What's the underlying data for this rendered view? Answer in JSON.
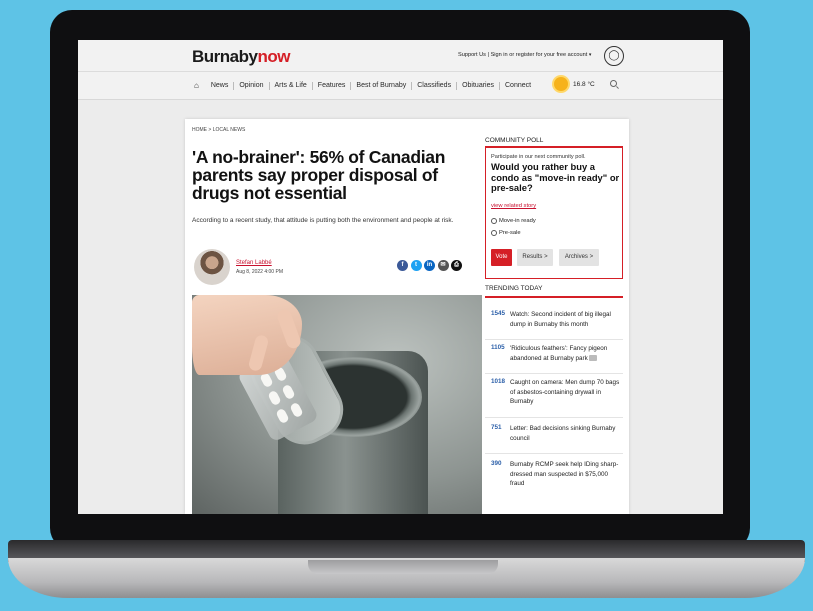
{
  "header": {
    "logo_part1": "Burnaby",
    "logo_part2": "now",
    "support": "Support Us",
    "signin": "Sign in or register for your free account",
    "caret": "▾"
  },
  "nav": {
    "items": [
      "News",
      "Opinion",
      "Arts & Life",
      "Features",
      "Best of Burnaby",
      "Classifieds",
      "Obituaries",
      "Connect"
    ],
    "temperature": "16.8 °C"
  },
  "article": {
    "breadcrumb": "HOME > LOCAL NEWS",
    "headline": "'A no-brainer': 56% of Canadian parents say proper disposal of drugs not essential",
    "subhead": "According to a recent study, that attitude is putting both the environment and people at risk.",
    "author": "Stefan Labbé",
    "date": "Aug 8, 2022 4:00 PM",
    "share": [
      "f",
      "t",
      "in",
      "✉",
      "⎙"
    ]
  },
  "poll": {
    "heading": "COMMUNITY POLL",
    "intro": "Participate in our next community poll.",
    "question": "Would you rather buy a condo as \"move-in ready\" or pre-sale?",
    "link": "view related story",
    "options": [
      "Move-in ready",
      "Pre-sale"
    ],
    "vote": "Vote",
    "results": "Results >",
    "archives": "Archives >"
  },
  "trending": {
    "heading": "TRENDING TODAY",
    "items": [
      {
        "num": "1545",
        "text": "Watch: Second incident of big illegal dump in Burnaby this month"
      },
      {
        "num": "1105",
        "text": "'Ridiculous feathers': Fancy pigeon abandoned at Burnaby park"
      },
      {
        "num": "1018",
        "text": "Caught on camera: Men dump 70 bags of asbestos-containing drywall in Burnaby"
      },
      {
        "num": "751",
        "text": "Letter: Bad decisions sinking Burnaby council"
      },
      {
        "num": "390",
        "text": "Burnaby RCMP seek help IDing sharp-dressed man suspected in $75,000 fraud"
      }
    ]
  },
  "colors": {
    "brand_red": "#d51f26",
    "link_blue": "#2a5ea8",
    "background": "#5ec3e6"
  }
}
